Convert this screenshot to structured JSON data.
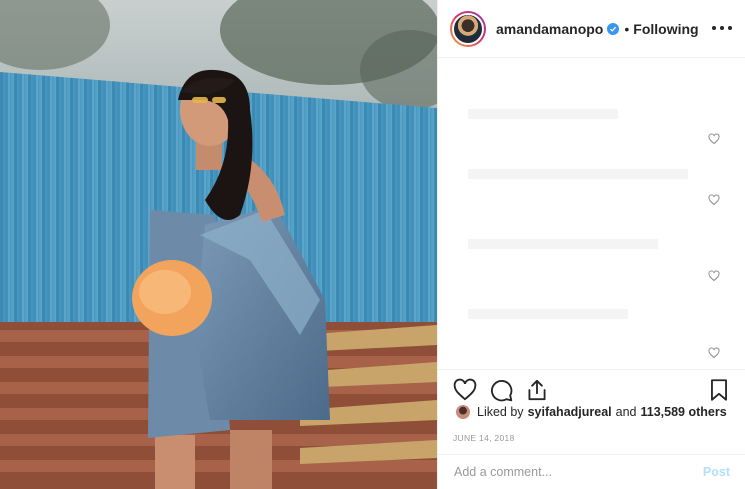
{
  "post": {
    "photo_alt": "Post photo",
    "username": "amandamanopo",
    "separator": "•",
    "follow_status": "Following",
    "more_icon": "more-options-icon",
    "comment_like_icons": [
      "heart-icon",
      "heart-icon",
      "heart-icon",
      "heart-icon"
    ],
    "actions": {
      "like_icon": "heart-icon",
      "comment_icon": "comment-bubble-icon",
      "share_icon": "share-icon",
      "save_icon": "bookmark-icon"
    },
    "likes": {
      "prefix": "Liked by",
      "user": "syifahadjureal",
      "conjunction": "and",
      "count": "113,589 others"
    },
    "date": "JUNE 14, 2018",
    "comment_placeholder": "Add a comment...",
    "post_label": "Post"
  },
  "colors": {
    "verified_badge": "#3897f0",
    "post_button_disabled": "#b2dffc",
    "muted_text": "#999999"
  }
}
